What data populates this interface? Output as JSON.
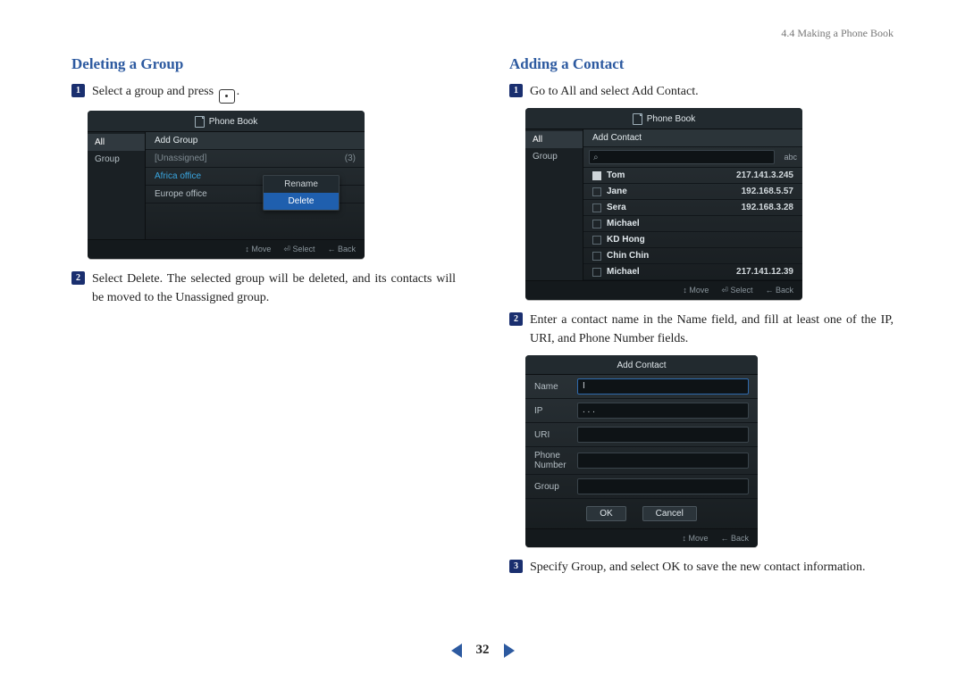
{
  "breadcrumb": "4.4 Making a Phone Book",
  "page_number": "32",
  "left": {
    "heading": "Deleting a Group",
    "step1_pre": "Select a group and press",
    "step1_post": ".",
    "step2": "Select Delete. The selected group will be deleted, and its contacts will be moved to the Unassigned group.",
    "shot": {
      "title": "Phone Book",
      "side": {
        "all": "All",
        "group": "Group"
      },
      "header": "Add Group",
      "rows": {
        "unassigned_label": "[Unassigned]",
        "unassigned_count": "(3)",
        "africa": "Africa office",
        "europe": "Europe office"
      },
      "menu": {
        "rename": "Rename",
        "delete": "Delete"
      },
      "footer": {
        "move": "↕ Move",
        "select": "⏎ Select",
        "back": "← Back"
      }
    }
  },
  "right": {
    "heading": "Adding a Contact",
    "step1": "Go to All and select Add Contact.",
    "step2": "Enter a contact name in the Name field, and fill at least one of the IP, URI, and Phone Number fields.",
    "step3": "Specify Group, and select OK to save the new contact information.",
    "shot_list": {
      "title": "Phone Book",
      "side": {
        "all": "All",
        "group": "Group"
      },
      "header": "Add Contact",
      "search_icon": "⌕",
      "ime": "abc",
      "contacts": [
        {
          "name": "Tom",
          "ip": "217.141.3.245",
          "checked": true
        },
        {
          "name": "Jane",
          "ip": "192.168.5.57",
          "checked": false
        },
        {
          "name": "Sera",
          "ip": "192.168.3.28",
          "checked": false
        },
        {
          "name": "Michael",
          "ip": "",
          "checked": false
        },
        {
          "name": "KD Hong",
          "ip": "",
          "checked": false
        },
        {
          "name": "Chin Chin",
          "ip": "",
          "checked": false
        },
        {
          "name": "Michael",
          "ip": "217.141.12.39",
          "checked": false
        }
      ],
      "footer": {
        "move": "↕ Move",
        "select": "⏎ Select",
        "back": "← Back"
      }
    },
    "shot_form": {
      "title": "Add Contact",
      "labels": {
        "name": "Name",
        "ip": "IP",
        "uri": "URI",
        "phone": "Phone\nNumber",
        "group": "Group"
      },
      "name_value": "I",
      "ip_value": " .         .         . ",
      "ok": "OK",
      "cancel": "Cancel",
      "footer": {
        "move": "↕ Move",
        "back": "← Back"
      }
    }
  }
}
